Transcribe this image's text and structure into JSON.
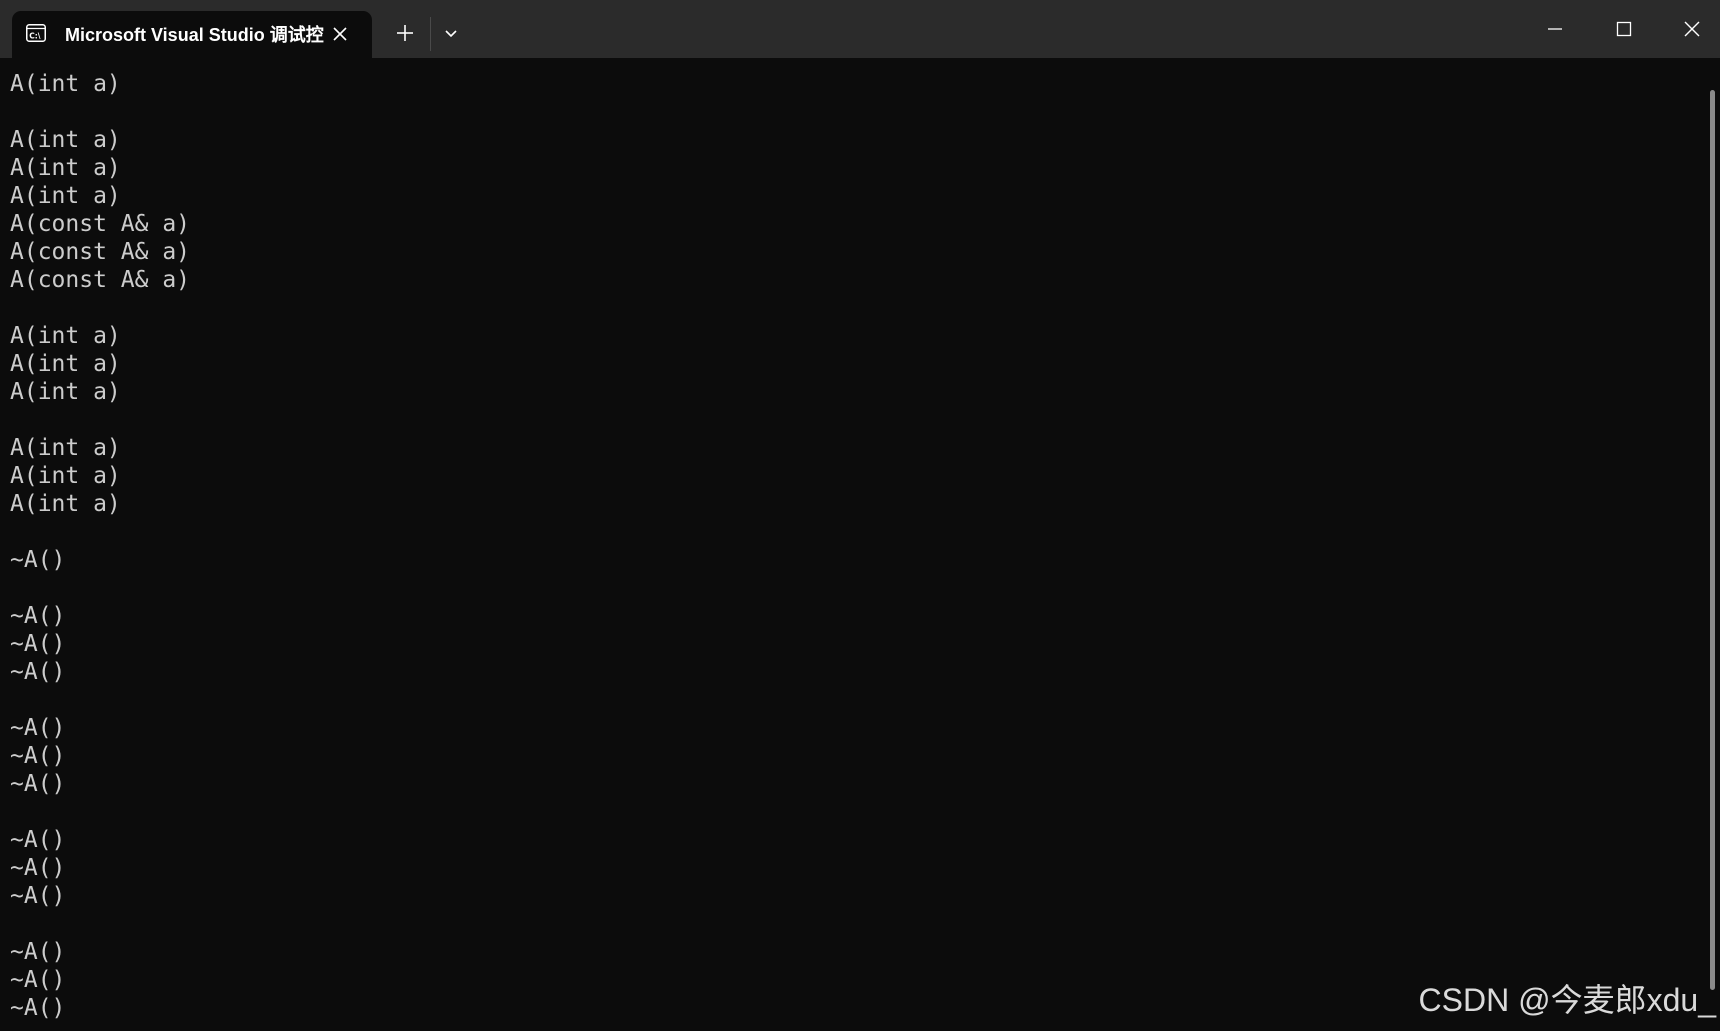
{
  "window": {
    "tab_title": "Microsoft Visual Studio 调试控",
    "tab_icon": "console-icon"
  },
  "console": {
    "lines": [
      "A(int a)",
      "",
      "A(int a)",
      "A(int a)",
      "A(int a)",
      "A(const A& a)",
      "A(const A& a)",
      "A(const A& a)",
      "",
      "A(int a)",
      "A(int a)",
      "A(int a)",
      "",
      "A(int a)",
      "A(int a)",
      "A(int a)",
      "",
      "~A()",
      "",
      "~A()",
      "~A()",
      "~A()",
      "",
      "~A()",
      "~A()",
      "~A()",
      "",
      "~A()",
      "~A()",
      "~A()",
      "",
      "~A()",
      "~A()",
      "~A()"
    ]
  },
  "watermark": "CSDN @今麦郎xdu_",
  "colors": {
    "titlebar": "#2b2b2b",
    "background": "#0c0c0c",
    "text": "#cccccc"
  }
}
